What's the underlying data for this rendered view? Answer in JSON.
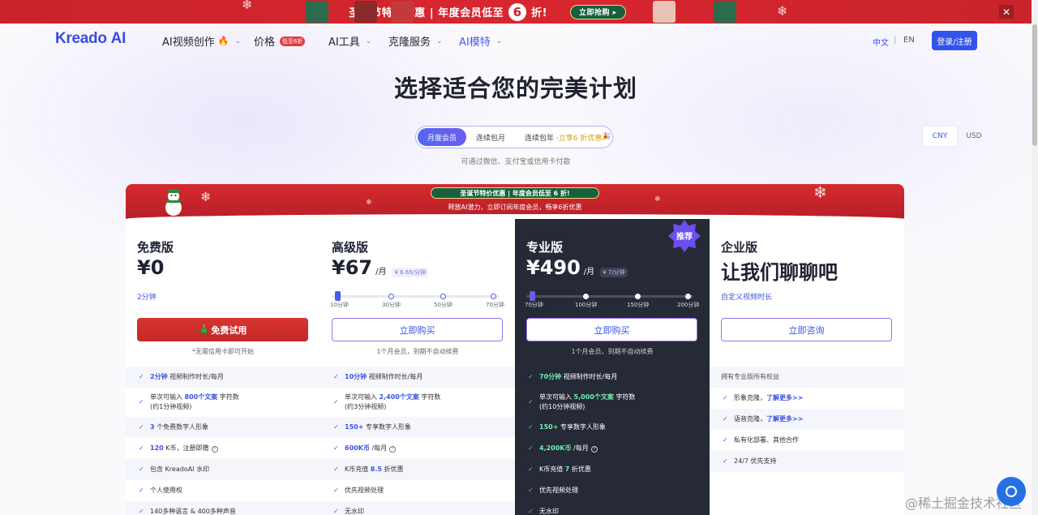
{
  "promo": {
    "text_before": "圣诞节特价优惠 | 年度会员低至",
    "big_number": "6",
    "text_after": "折!",
    "button": "立即抢购 ▸",
    "close": "✕"
  },
  "nav": {
    "logo_text": "Kreado",
    "logo_ai": "AI",
    "items": [
      {
        "label": "AI视频创作"
      },
      {
        "label": "价格",
        "badge": "低至6折"
      },
      {
        "label": "AI工具"
      },
      {
        "label": "克隆服务"
      },
      {
        "label": "AI模特"
      }
    ],
    "lang_cn": "中文",
    "lang_sep": "|",
    "lang_en": "EN",
    "login": "登录/注册"
  },
  "hero": {
    "title": "选择适合您的完美计划",
    "billing_options": [
      "月度会员",
      "连续包月"
    ],
    "billing_option_3_prefix": "连续包年 · ",
    "billing_option_3_highlight": "立享6 折优惠",
    "billing_option_3_emoji": "🎉",
    "pay_note": "可通过微信、支付宝或信用卡付款",
    "currency": [
      "CNY",
      "USD"
    ]
  },
  "xmas": {
    "pill": "圣诞节特价优惠 | 年度会员低至 6 折!",
    "sub": "释放AI潜力，立即订阅年度会员，畅享6折优惠"
  },
  "plans": {
    "free": {
      "name": "免费版",
      "price": "¥0",
      "minutes": "2分钟",
      "cta": "免费试用",
      "note": "*无需信用卡即可开始",
      "feats": {
        "f1_hl": "2分钟",
        "f1_rest": " 视频制作时长/每月",
        "f2_a": "单次可输入 ",
        "f2_hl": "800个文案",
        "f2_b": " 字符数",
        "f2_c": "(约1分钟视频)",
        "f3_hl": "3",
        "f3_rest": " 个免费数字人形象",
        "f4_hl": "120",
        "f4_rest": " K币，注册即赠",
        "f5": "包含 KreadoAI 水印",
        "f6": "个人使用权",
        "f7": "140多种语言 & 400多种声音"
      }
    },
    "premium": {
      "name": "高级版",
      "price": "¥67",
      "unit": "/月",
      "tag": "¥ 6.65/分钟",
      "slider_labels": [
        "10分钟",
        "30分钟",
        "50分钟",
        "70分钟"
      ],
      "cta": "立即购买",
      "note": "1个月会员，到期不自动续费",
      "feats": {
        "f1_hl": "10分钟",
        "f1_rest": " 视频制作时长/每月",
        "f2_a": "单次可输入 ",
        "f2_hl": "2,400个文案",
        "f2_b": " 字符数",
        "f2_c": "(约3分钟视频)",
        "f3_hl": "150+",
        "f3_rest": " 专享数字人形象",
        "f4_hl": "600K币",
        "f4_rest": " /每月",
        "f5_a": "K币充值 ",
        "f5_hl": "8.5",
        "f5_b": " 折优惠",
        "f6": "优先视频处理",
        "f7": "无水印"
      }
    },
    "pro": {
      "name": "专业版",
      "price": "¥490",
      "unit": "/月",
      "tag": "¥ 7/分钟",
      "badge": "推荐",
      "slider_labels": [
        "70分钟",
        "100分钟",
        "150分钟",
        "200分钟"
      ],
      "cta": "立即购买",
      "note": "1个月会员，到期不自动续费",
      "feats": {
        "f1_hl": "70分钟",
        "f1_rest": " 视频制作时长/每月",
        "f2_a": "单次可输入 ",
        "f2_hl": "5,000个文案",
        "f2_b": " 字符数",
        "f2_c": "(约10分钟视频)",
        "f3_hl": "150+",
        "f3_rest": " 专享数字人形象",
        "f4_hl": "4,200K币",
        "f4_rest": " /每月",
        "f5_a": "K币充值 ",
        "f5_hl": "7",
        "f5_b": " 折优惠",
        "f6": "优先视频处理",
        "f7": "无水印"
      }
    },
    "enterprise": {
      "name": "企业版",
      "price": "让我们聊聊吧",
      "minutes": "自定义视频时长",
      "cta": "立即咨询",
      "feats": {
        "f1": "拥有专业版所有权益",
        "f2_a": "形象克隆，",
        "f2_link": "了解更多>>",
        "f3_a": "语音克隆，",
        "f3_link": "了解更多>>",
        "f4": "私有化部署、其他合作",
        "f5": "24/7 优先支持"
      }
    }
  },
  "watermark": "@稀土掘金技术社区",
  "colors": {
    "accent": "#3452ec",
    "promo_red": "#c9232c",
    "pro_bg": "#262a36",
    "check_green": "#4cc88a"
  }
}
